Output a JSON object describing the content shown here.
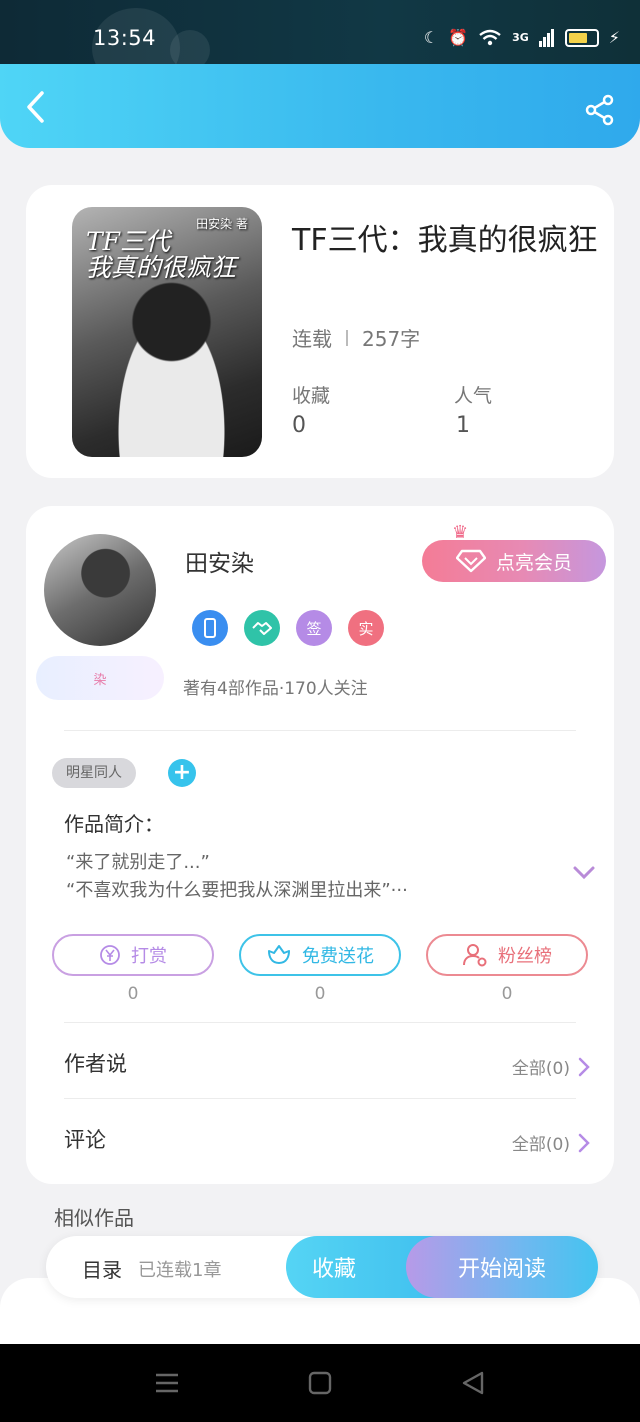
{
  "status_bar": {
    "time": "13:54",
    "network": "3G"
  },
  "header": {
    "back_icon": "chevron-left-icon",
    "share_icon": "share-icon"
  },
  "book": {
    "title": "TF三代：我真的很疯狂",
    "cover_title_line1": "TF三代",
    "cover_title_line2": "我真的很疯狂",
    "cover_author": "田安染 著",
    "status": "连载",
    "word_count": "257字",
    "favorites_label": "收藏",
    "favorites_value": "0",
    "popularity_label": "人气",
    "popularity_value": "1"
  },
  "author": {
    "name": "田安染",
    "frame_text": "染",
    "vip_label": "点亮会员",
    "badges": [
      {
        "text": "",
        "color": "#3a8ef0"
      },
      {
        "text": "",
        "color": "#2fc3a8"
      },
      {
        "text": "签",
        "color": "#b58be6"
      },
      {
        "text": "实",
        "color": "#f07080"
      }
    ],
    "meta": "著有4部作品·170人关注"
  },
  "tags": [
    "明星同人"
  ],
  "intro": {
    "label": "作品简介：",
    "lines": [
      "“来了就别走了...”",
      "“不喜欢我为什么要把我从深渊里拉出来”···"
    ]
  },
  "actions": [
    {
      "label": "打赏",
      "count": "0",
      "icon": "yuan-icon",
      "color": "#b98bd8"
    },
    {
      "label": "免费送花",
      "count": "0",
      "icon": "flower-icon",
      "color": "#3ec3e8"
    },
    {
      "label": "粉丝榜",
      "count": "0",
      "icon": "user-icon",
      "color": "#e8707a"
    }
  ],
  "author_notes": {
    "title": "作者说",
    "link": "全部(0)"
  },
  "comments": {
    "title": "评论",
    "link": "全部(0)"
  },
  "similar": {
    "title": "相似作品"
  },
  "bottom_bar": {
    "toc": "目录",
    "toc_sub": "已连载1章",
    "favorite": "收藏",
    "read": "开始阅读"
  },
  "colors": {
    "accent": "#3dbdee",
    "vip": "#e78ab4"
  }
}
